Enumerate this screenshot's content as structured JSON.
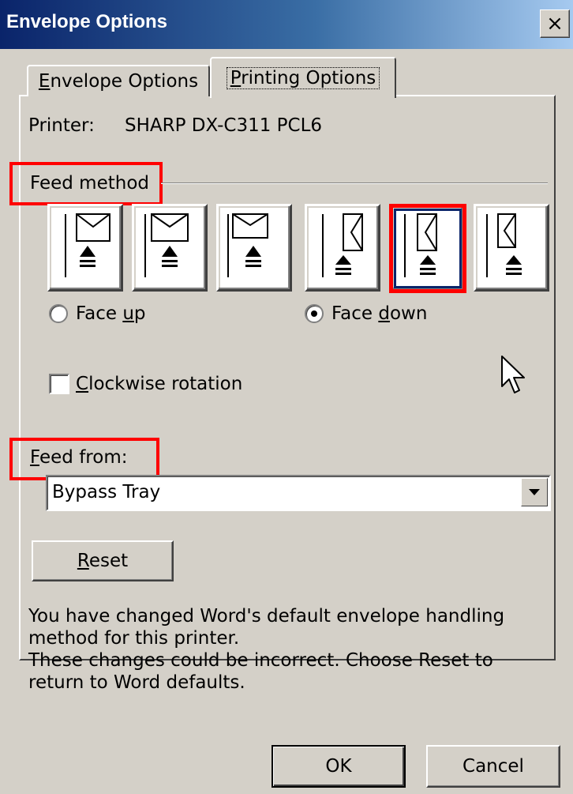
{
  "window": {
    "title": "Envelope Options",
    "close_glyph": "×"
  },
  "tabs": [
    {
      "label": "Envelope Options",
      "mnemonic_prefix": "",
      "mnemonic": "E",
      "rest": "nvelope Options"
    },
    {
      "label": "Printing Options",
      "mnemonic_prefix": "",
      "mnemonic": "P",
      "rest": "rinting Options"
    }
  ],
  "printer": {
    "label": "Printer:",
    "value": "SHARP DX-C311 PCL6"
  },
  "feed_method": {
    "label": "Feed method",
    "options": [
      {
        "orientation": "horizontal",
        "position": "left",
        "selected": false
      },
      {
        "orientation": "horizontal",
        "position": "center",
        "selected": false
      },
      {
        "orientation": "horizontal",
        "position": "right",
        "selected": false
      },
      {
        "orientation": "vertical",
        "position": "left",
        "selected": false
      },
      {
        "orientation": "vertical",
        "position": "center",
        "selected": true
      },
      {
        "orientation": "vertical",
        "position": "right",
        "selected": false
      }
    ],
    "face_up": {
      "pre": "Face ",
      "mnemonic": "u",
      "post": "p",
      "checked": false
    },
    "face_down": {
      "pre": "Face ",
      "mnemonic": "d",
      "post": "own",
      "checked": true
    },
    "clockwise": {
      "pre": "",
      "mnemonic": "C",
      "post": "lockwise rotation",
      "checked": false
    }
  },
  "feed_from": {
    "label_mnemonic": "F",
    "label_rest": "eed from:",
    "selected": "Bypass Tray"
  },
  "reset_button": {
    "mnemonic": "R",
    "rest": "eset"
  },
  "message": [
    "You have changed Word's default envelope handling method for this printer.",
    "These changes could be incorrect. Choose Reset to return to Word defaults."
  ],
  "ok_button": "OK",
  "cancel_button": "Cancel",
  "colors": {
    "highlight": "#ff0000",
    "titlebar_start": "#0a246a",
    "titlebar_end": "#a6caf0",
    "face": "#d4d0c8"
  }
}
